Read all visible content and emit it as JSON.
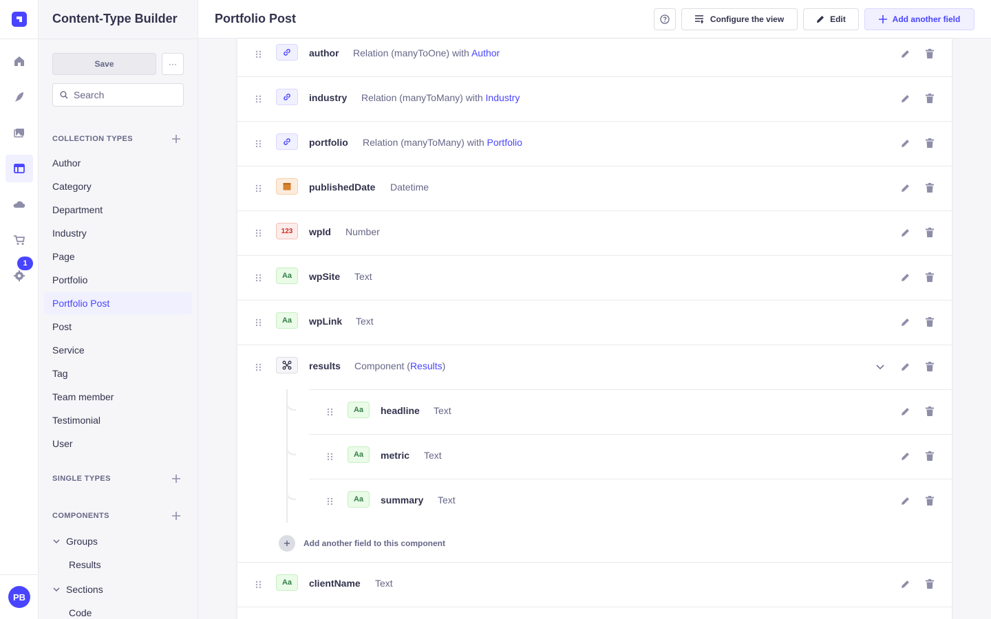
{
  "app": {
    "rail": {
      "items": [
        "home-icon",
        "content-manager-icon",
        "media-library-icon",
        "content-type-builder-icon",
        "cloud-icon",
        "marketplace-icon",
        "settings-icon"
      ],
      "badge": "1",
      "user_initials": "PB"
    },
    "subnav": {
      "title": "Content-Type Builder",
      "save_label": "Save",
      "more_label": "···",
      "search_placeholder": "Search",
      "collection_types_label": "COLLECTION TYPES",
      "collection_types": [
        "Author",
        "Category",
        "Department",
        "Industry",
        "Page",
        "Portfolio",
        "Portfolio Post",
        "Post",
        "Service",
        "Tag",
        "Team member",
        "Testimonial",
        "User"
      ],
      "active_item": "Portfolio Post",
      "single_types_label": "SINGLE TYPES",
      "components_label": "COMPONENTS",
      "component_groups": [
        {
          "name": "Groups",
          "children": [
            "Results"
          ]
        },
        {
          "name": "Sections",
          "children": [
            "Code"
          ]
        }
      ]
    },
    "header": {
      "title": "Portfolio Post",
      "configure_label": "Configure the view",
      "edit_label": "Edit",
      "add_field_label": "Add another field"
    },
    "fields": [
      {
        "name": "author",
        "type_prefix": "Relation (manyToOne) with ",
        "type_link": "Author",
        "type_suffix": "",
        "icon": "relation"
      },
      {
        "name": "industry",
        "type_prefix": "Relation (manyToMany) with ",
        "type_link": "Industry",
        "type_suffix": "",
        "icon": "relation"
      },
      {
        "name": "portfolio",
        "type_prefix": "Relation (manyToMany) with ",
        "type_link": "Portfolio",
        "type_suffix": "",
        "icon": "relation"
      },
      {
        "name": "publishedDate",
        "type_prefix": "Datetime",
        "type_link": "",
        "type_suffix": "",
        "icon": "date"
      },
      {
        "name": "wpId",
        "type_prefix": "Number",
        "type_link": "",
        "type_suffix": "",
        "icon": "number"
      },
      {
        "name": "wpSite",
        "type_prefix": "Text",
        "type_link": "",
        "type_suffix": "",
        "icon": "text"
      },
      {
        "name": "wpLink",
        "type_prefix": "Text",
        "type_link": "",
        "type_suffix": "",
        "icon": "text"
      },
      {
        "name": "results",
        "type_prefix": "Component (",
        "type_link": "Results",
        "type_suffix": ")",
        "icon": "component"
      }
    ],
    "component_fields": [
      {
        "name": "headline",
        "type": "Text"
      },
      {
        "name": "metric",
        "type": "Text"
      },
      {
        "name": "summary",
        "type": "Text"
      }
    ],
    "add_component_field_label": "Add another field to this component",
    "last_field": {
      "name": "clientName",
      "type": "Text"
    },
    "icon_labels": {
      "number": "123",
      "text": "Aa"
    },
    "colors": {
      "primary": "#4945ff",
      "text": "#32324d",
      "muted": "#666687"
    }
  }
}
